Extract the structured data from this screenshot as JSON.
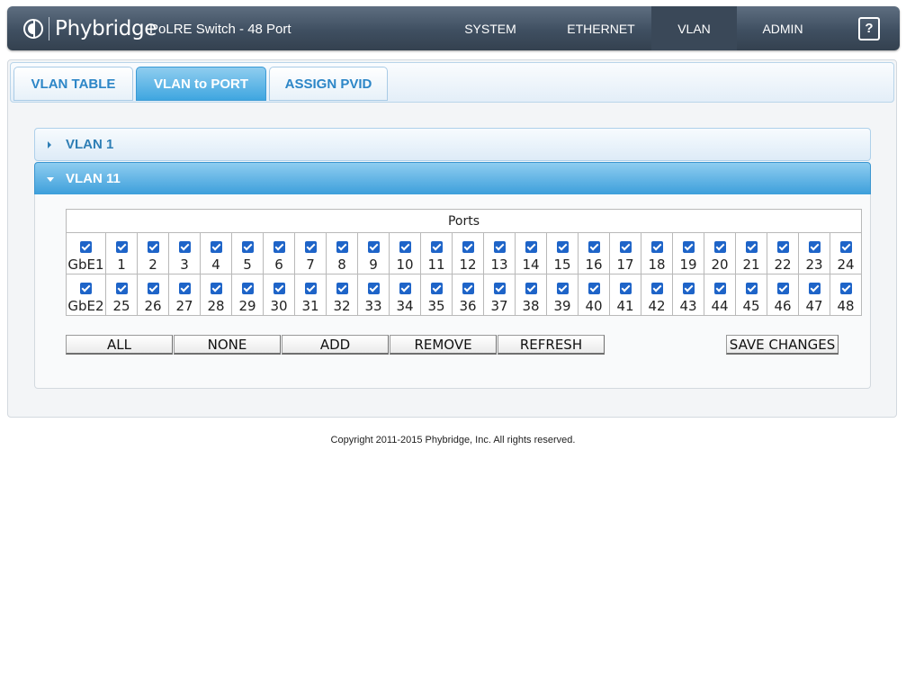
{
  "header": {
    "brand": "Phybridge",
    "device_title": "PoLRE Switch - 48 Port",
    "nav": [
      {
        "label": "SYSTEM",
        "active": false
      },
      {
        "label": "ETHERNET",
        "active": false
      },
      {
        "label": "VLAN",
        "active": true
      },
      {
        "label": "ADMIN",
        "active": false
      }
    ],
    "help_label": "?"
  },
  "tabs": [
    {
      "label": "VLAN TABLE",
      "active": false
    },
    {
      "label": "VLAN to PORT",
      "active": true
    },
    {
      "label": "ASSIGN PVID",
      "active": false
    }
  ],
  "vlans": [
    {
      "label": "VLAN 1",
      "expanded": false
    },
    {
      "label": "VLAN 11",
      "expanded": true
    }
  ],
  "ports_table": {
    "caption": "Ports",
    "rows": [
      {
        "all_label": "GbE1",
        "ports": [
          "1",
          "2",
          "3",
          "4",
          "5",
          "6",
          "7",
          "8",
          "9",
          "10",
          "11",
          "12",
          "13",
          "14",
          "15",
          "16",
          "17",
          "18",
          "19",
          "20",
          "21",
          "22",
          "23",
          "24"
        ]
      },
      {
        "all_label": "GbE2",
        "ports": [
          "25",
          "26",
          "27",
          "28",
          "29",
          "30",
          "31",
          "32",
          "33",
          "34",
          "35",
          "36",
          "37",
          "38",
          "39",
          "40",
          "41",
          "42",
          "43",
          "44",
          "45",
          "46",
          "47",
          "48"
        ]
      }
    ],
    "all_checked": true
  },
  "buttons": {
    "all": "ALL",
    "none": "NONE",
    "add": "ADD",
    "remove": "REMOVE",
    "refresh": "REFRESH",
    "save": "SAVE CHANGES"
  },
  "footer": "Copyright 2011-2015 Phybridge, Inc. All rights reserved.",
  "colors": {
    "header_bg": "#3f4f61",
    "accent": "#3fa6e0",
    "checkbox": "#1e64c8"
  }
}
